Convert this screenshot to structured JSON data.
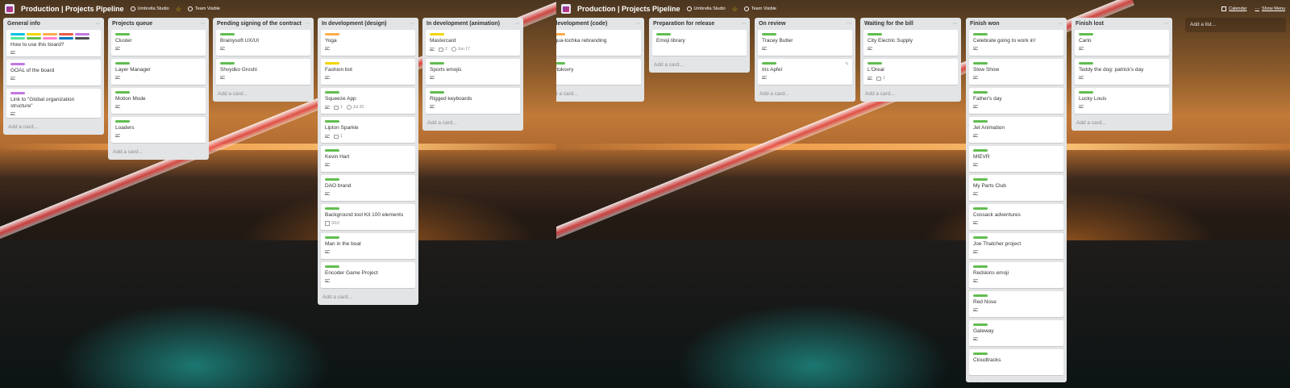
{
  "colors": {
    "green": "#61bd4f",
    "yellow": "#f2d600",
    "orange": "#ffab4a",
    "red": "#eb5a46",
    "purple": "#c377e0",
    "blue": "#0079bf",
    "sky": "#00c2e0",
    "lime": "#51e898",
    "pink": "#ff80ce",
    "black": "#4d4d4d"
  },
  "header": {
    "board_title": "Production | Projects Pipeline",
    "team": "Umbrella Studio",
    "visibility": "Team Visible",
    "calendar": "Calendar",
    "show_menu": "Show Menu"
  },
  "left": {
    "lists": [
      {
        "title": "General info",
        "add": "Add a card...",
        "cards": [
          {
            "title": "How to use this board?",
            "labels": [
              "sky",
              "yellow",
              "orange",
              "red",
              "purple",
              "lime",
              "green",
              "pink",
              "blue",
              "black"
            ],
            "desc": true
          },
          {
            "title": "GOAL of the board",
            "labels": [
              "purple"
            ],
            "desc": true
          },
          {
            "title": "Link to \"Global organization structure\"",
            "labels": [
              "purple"
            ],
            "desc": true
          }
        ]
      },
      {
        "title": "Projects queue",
        "add": "Add a card...",
        "cards": [
          {
            "title": "Cluster",
            "labels": [
              "green"
            ],
            "desc": true
          },
          {
            "title": "Layer Manager",
            "labels": [
              "green"
            ],
            "desc": true
          },
          {
            "title": "Motion Mode",
            "labels": [
              "green"
            ],
            "desc": true
          },
          {
            "title": "Loaders",
            "labels": [
              "green"
            ],
            "desc": true
          }
        ]
      },
      {
        "title": "Pending signing of the contract",
        "add": "Add a card...",
        "cards": [
          {
            "title": "Brainysoft UX/UI",
            "labels": [
              "green"
            ],
            "desc": true
          },
          {
            "title": "Shvydko Groshi",
            "labels": [
              "green"
            ],
            "desc": true
          }
        ]
      },
      {
        "title": "In development (design)",
        "add": "Add a card...",
        "cards": [
          {
            "title": "Yoga",
            "labels": [
              "orange"
            ],
            "desc": true
          },
          {
            "title": "Fashion bot",
            "labels": [
              "yellow"
            ],
            "desc": true
          },
          {
            "title": "Squeeze App",
            "labels": [
              "green"
            ],
            "desc": true,
            "comments": "1",
            "due": "Jul 20"
          },
          {
            "title": "Lipton Sparkle",
            "labels": [
              "green"
            ],
            "desc": true,
            "comments": "1"
          },
          {
            "title": "Kevin Hart",
            "labels": [
              "green"
            ],
            "desc": true
          },
          {
            "title": "DAO brand",
            "labels": [
              "green"
            ],
            "desc": true
          },
          {
            "title": "Background tool Kit 100 elements",
            "labels": [
              "green"
            ],
            "checklist": "3/10"
          },
          {
            "title": "Man in the boat",
            "labels": [
              "green"
            ],
            "desc": true
          },
          {
            "title": "Encoder Game Project",
            "labels": [
              "green"
            ],
            "desc": true
          }
        ]
      },
      {
        "title": "In development (animation)",
        "add": "Add a card...",
        "cards": [
          {
            "title": "Mastercard",
            "labels": [
              "yellow"
            ],
            "desc": true,
            "comments": "2",
            "due": "Jun 17"
          },
          {
            "title": "Sports emojis",
            "labels": [
              "green"
            ],
            "desc": true
          },
          {
            "title": "Rigged keyboards",
            "labels": [
              "green"
            ],
            "desc": true
          }
        ]
      }
    ]
  },
  "right": {
    "lists": [
      {
        "title": "In development (code)",
        "add": "Add a card...",
        "cards": [
          {
            "title": "Aqua-tochka rebranding",
            "labels": [
              "orange"
            ],
            "desc": true
          },
          {
            "title": "Avtokovry",
            "labels": [
              "green"
            ],
            "desc": true
          }
        ]
      },
      {
        "title": "Preparation for release",
        "add": "Add a card...",
        "cards": [
          {
            "title": "Emoji library",
            "labels": [
              "green"
            ]
          }
        ]
      },
      {
        "title": "On review",
        "add": "Add a card...",
        "cards": [
          {
            "title": "Tracey Butler",
            "labels": [
              "green"
            ],
            "desc": true
          },
          {
            "title": "Iris Apfel",
            "labels": [
              "green"
            ],
            "desc": true,
            "edit": true
          }
        ]
      },
      {
        "title": "Waiting for the bill",
        "add": "Add a card...",
        "cards": [
          {
            "title": "City Electric Supply",
            "labels": [
              "green"
            ],
            "desc": true
          },
          {
            "title": "L'Oreal",
            "labels": [
              "green"
            ],
            "desc": true,
            "comments": "1"
          }
        ]
      },
      {
        "title": "Finish won",
        "add": "Add a card...",
        "cards": [
          {
            "title": "Celebrate going to work in!",
            "labels": [
              "green"
            ],
            "desc": true
          },
          {
            "title": "Slow Show",
            "labels": [
              "green"
            ],
            "desc": true
          },
          {
            "title": "Father's day",
            "labels": [
              "green"
            ],
            "desc": true
          },
          {
            "title": "Jet Animation",
            "labels": [
              "green"
            ],
            "desc": true
          },
          {
            "title": "MIEVR",
            "labels": [
              "green"
            ],
            "desc": true
          },
          {
            "title": "My Parts Club",
            "labels": [
              "green"
            ],
            "desc": true
          },
          {
            "title": "Cossack adventures",
            "labels": [
              "green"
            ],
            "desc": true
          },
          {
            "title": "Joe Thatcher project",
            "labels": [
              "green"
            ],
            "desc": true
          },
          {
            "title": "Redskins emoji",
            "labels": [
              "green"
            ],
            "desc": true
          },
          {
            "title": "Red Nose",
            "labels": [
              "green"
            ],
            "desc": true
          },
          {
            "title": "Gateway",
            "labels": [
              "green"
            ],
            "desc": true
          },
          {
            "title": "Cloudtracks",
            "labels": [
              "green"
            ]
          }
        ]
      },
      {
        "title": "Finish lost",
        "add": "Add a card...",
        "cards": [
          {
            "title": "Carlo",
            "labels": [
              "green"
            ],
            "desc": true
          },
          {
            "title": "Teddy the dog: patrick's day",
            "labels": [
              "green"
            ],
            "desc": true
          },
          {
            "title": "Lucky Louis",
            "labels": [
              "green"
            ],
            "desc": true
          }
        ]
      }
    ],
    "add_list": "Add a list..."
  }
}
